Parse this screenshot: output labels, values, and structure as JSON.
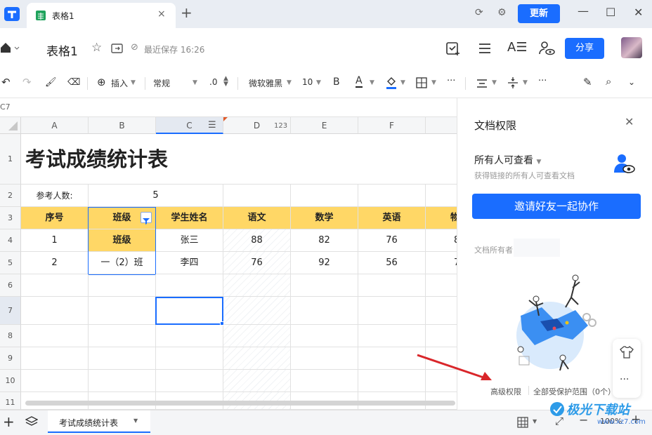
{
  "tab": {
    "title": "表格1",
    "close": "×",
    "new": "+"
  },
  "titlebar": {
    "update_label": "更新"
  },
  "header": {
    "doc_title": "表格1",
    "saved_text": "最近保存 16:26",
    "share_label": "分享"
  },
  "toolbar": {
    "insert_label": "插入",
    "format_label": "常规",
    "decimal_label": ".0",
    "font_label": "微软雅黑",
    "size_label": "10",
    "bold_label": "B",
    "fontcolor_label": "A",
    "more_label": "···",
    "more2_label": "···"
  },
  "cellref": "C7",
  "grid": {
    "columns": [
      "A",
      "B",
      "C",
      "D",
      "E",
      "F"
    ],
    "col_badge": "123",
    "rows": [
      "1",
      "2",
      "3",
      "4",
      "5",
      "6",
      "7",
      "8",
      "9",
      "10",
      "11"
    ],
    "title": "考试成绩统计表",
    "count_label": "参考人数:",
    "count_value": "5",
    "headers": [
      "序号",
      "班级",
      "学生姓名",
      "语文",
      "数学",
      "英语",
      "物"
    ],
    "row4": [
      "1",
      "班级",
      "张三",
      "88",
      "82",
      "76",
      "8"
    ],
    "row5": [
      "2",
      "一（2）班",
      "李四",
      "76",
      "92",
      "56",
      "7"
    ]
  },
  "panel": {
    "title": "文档权限",
    "access_label": "所有人可查看",
    "access_desc": "获得链接的所有人可查看文档",
    "invite_label": "邀请好友一起协作",
    "owner_label": "文档所有者",
    "advanced_label": "高级权限",
    "protect_label": "全部受保护范围（0个）"
  },
  "bottom": {
    "sheet_name": "考试成绩统计表",
    "zoom": "100%"
  },
  "watermark": {
    "name": "极光下载站",
    "url": "www.xz7.com"
  },
  "colors": {
    "accent": "#1a6dff",
    "header_fill": "#ffd766",
    "selection": "#1a6dff",
    "arrow": "#d9262a"
  }
}
